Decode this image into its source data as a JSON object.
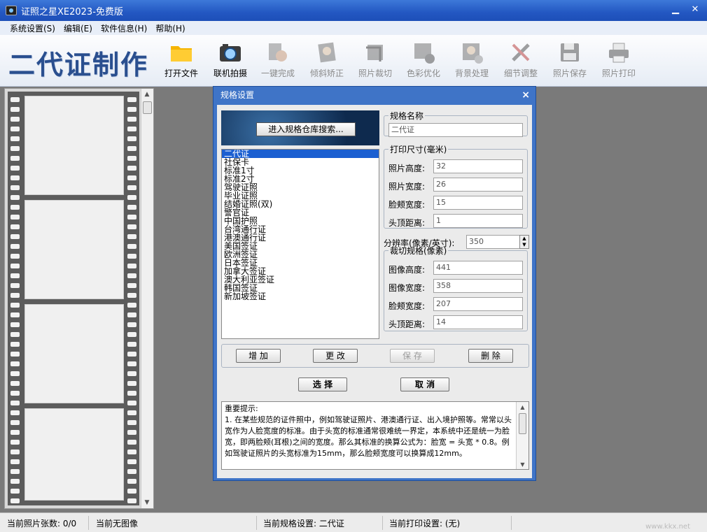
{
  "window": {
    "title": "证照之星XE2023-免费版"
  },
  "menu": [
    "系统设置(S)",
    "编辑(E)",
    "软件信息(H)",
    "帮助(H)"
  ],
  "brand": "二代证制作",
  "toolbar": [
    {
      "label": "打开文件",
      "icon": "folder-icon",
      "enabled": true
    },
    {
      "label": "联机拍摄",
      "icon": "camera-icon",
      "enabled": true
    },
    {
      "label": "一键完成",
      "icon": "auto-icon",
      "enabled": false
    },
    {
      "label": "倾斜矫正",
      "icon": "tilt-icon",
      "enabled": false
    },
    {
      "label": "照片裁切",
      "icon": "crop-icon",
      "enabled": false
    },
    {
      "label": "色彩优化",
      "icon": "color-icon",
      "enabled": false
    },
    {
      "label": "背景处理",
      "icon": "background-icon",
      "enabled": false
    },
    {
      "label": "细节调整",
      "icon": "tools-icon",
      "enabled": false
    },
    {
      "label": "照片保存",
      "icon": "save-icon",
      "enabled": false
    },
    {
      "label": "照片打印",
      "icon": "printer-icon",
      "enabled": false
    }
  ],
  "dialog": {
    "title": "规格设置",
    "close": "×",
    "search_button": "进入规格仓库搜索...",
    "spec_list": [
      "二代证",
      "社保卡",
      "标准1寸",
      "标准2寸",
      "驾驶证照",
      "毕业证照",
      "结婚证照(双)",
      "警官证",
      "中国护照",
      "台湾通行证",
      "港澳通行证",
      "美国签证",
      "欧洲签证",
      "日本签证",
      "加拿大签证",
      "澳大利亚签证",
      "韩国签证",
      "新加坡签证"
    ],
    "selected_index": 0,
    "name_group": {
      "legend": "规格名称",
      "value": "二代证"
    },
    "print_group": {
      "legend": "打印尺寸(毫米)",
      "fields": [
        {
          "label": "照片高度:",
          "value": "32"
        },
        {
          "label": "照片宽度:",
          "value": "26"
        },
        {
          "label": "脸颊宽度:",
          "value": "15"
        },
        {
          "label": "头顶距离:",
          "value": "1"
        }
      ]
    },
    "resolution": {
      "label": "分辨率(像素/英寸):",
      "value": "350"
    },
    "crop_group": {
      "legend": "裁切规格(像素)",
      "fields": [
        {
          "label": "图像高度:",
          "value": "441"
        },
        {
          "label": "图像宽度:",
          "value": "358"
        },
        {
          "label": "脸颊宽度:",
          "value": "207"
        },
        {
          "label": "头顶距离:",
          "value": "14"
        }
      ]
    },
    "buttons": {
      "add": "增 加",
      "modify": "更 改",
      "save": "保 存",
      "delete": "删 除",
      "select": "选 择",
      "cancel": "取 消"
    },
    "notes": {
      "heading": "重要提示:",
      "text": "1. 在某些规范的证件照中，例如驾驶证照片、港澳通行证、出入境护照等。常常以头宽作为人脸宽度的标准。由于头宽的标准通常很难统一界定，本系统中还是统一为脸宽，即两脸颊(耳根)之间的宽度。那么其标准的换算公式为：脸宽 = 头宽 * 0.8。例如驾驶证照片的头宽标准为15mm，那么脸颊宽度可以换算成12mm。"
    }
  },
  "status": {
    "count": "当前照片张数: 0/0",
    "image": "当前无图像",
    "spec": "当前规格设置: 二代证",
    "print": "当前打印设置: (无)"
  },
  "watermark": "www.kkx.net"
}
